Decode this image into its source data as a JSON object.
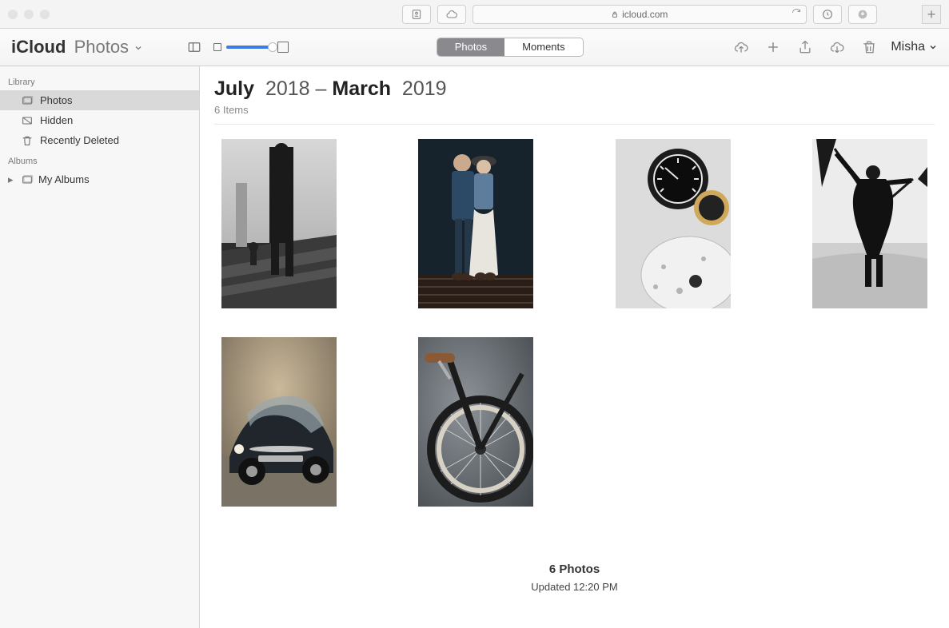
{
  "browser": {
    "domain": "icloud.com"
  },
  "app": {
    "title_prefix": "iCloud",
    "title_suffix": "Photos",
    "segments": {
      "photos": "Photos",
      "moments": "Moments"
    },
    "user": "Misha"
  },
  "sidebar": {
    "library_heading": "Library",
    "albums_heading": "Albums",
    "items": {
      "photos": "Photos",
      "hidden": "Hidden",
      "recently_deleted": "Recently Deleted",
      "my_albums": "My Albums"
    }
  },
  "main": {
    "range": {
      "start_month": "July",
      "start_year": "2018",
      "sep": " – ",
      "end_month": "March",
      "end_year": "2019"
    },
    "item_count": "6 Items",
    "thumbs": [
      {
        "name": "photo-rooftop-walk"
      },
      {
        "name": "photo-couple"
      },
      {
        "name": "photo-motorcycle-gauge"
      },
      {
        "name": "photo-umbrella-man"
      },
      {
        "name": "photo-vintage-car"
      },
      {
        "name": "photo-bicycle-wheel"
      }
    ],
    "footer": {
      "count": "6 Photos",
      "updated": "Updated 12:20 PM"
    }
  }
}
